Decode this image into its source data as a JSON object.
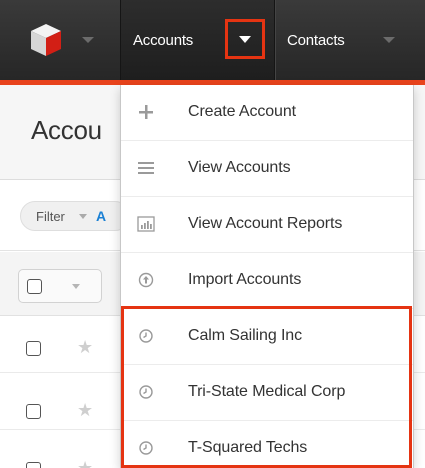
{
  "colors": {
    "accent": "#e8431c",
    "highlight": "#e53412",
    "nav_bg": "#2b2b2b",
    "link_blue": "#1a80d4"
  },
  "navbar": {
    "logo_icon": "sugar-cube-logo-icon",
    "tabs": [
      {
        "label": "Accounts",
        "active": true,
        "menu_open": true
      },
      {
        "label": "Contacts",
        "active": false
      }
    ]
  },
  "page": {
    "title": "Accou",
    "filter": {
      "label": "Filter",
      "value_fragment": "A"
    }
  },
  "dropdown": {
    "actions": [
      {
        "label": "Create Account",
        "icon": "plus-icon"
      },
      {
        "label": "View Accounts",
        "icon": "list-icon"
      },
      {
        "label": "View Account Reports",
        "icon": "bar-chart-icon"
      },
      {
        "label": "Import Accounts",
        "icon": "upload-circle-icon"
      }
    ],
    "recently_viewed": [
      {
        "label": "Calm Sailing Inc",
        "icon": "clock-icon"
      },
      {
        "label": "Tri-State Medical Corp",
        "icon": "clock-icon"
      },
      {
        "label": "T-Squared Techs",
        "icon": "clock-icon"
      }
    ]
  }
}
